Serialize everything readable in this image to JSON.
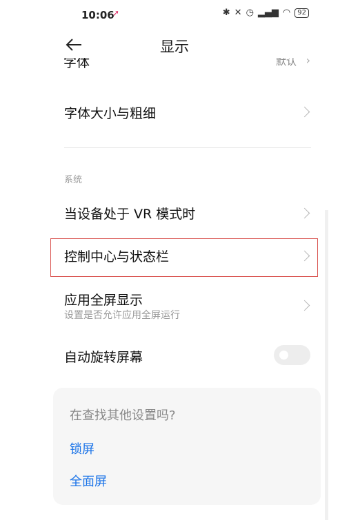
{
  "status_bar": {
    "time": "10:06",
    "icons": [
      "bluetooth-icon",
      "mute-icon",
      "alarm-icon",
      "signal-icon",
      "wifi-icon"
    ],
    "battery": "92"
  },
  "header": {
    "title": "显示"
  },
  "rows": {
    "font": {
      "label": "字体",
      "value": "默认"
    },
    "font_size": {
      "label": "字体大小与粗细"
    },
    "section_system": "系统",
    "vr_mode": {
      "label": "当设备处于 VR 模式时"
    },
    "control_center": {
      "label": "控制中心与状态栏"
    },
    "fullscreen_apps": {
      "label": "应用全屏显示",
      "sub": "设置是否允许应用全屏运行"
    },
    "auto_rotate": {
      "label": "自动旋转屏幕",
      "enabled": false
    }
  },
  "suggestions": {
    "question": "在查找其他设置吗?",
    "links": [
      "锁屏",
      "全面屏"
    ]
  },
  "colors": {
    "accent": "#1a73e8",
    "highlight": "#d9534f"
  }
}
